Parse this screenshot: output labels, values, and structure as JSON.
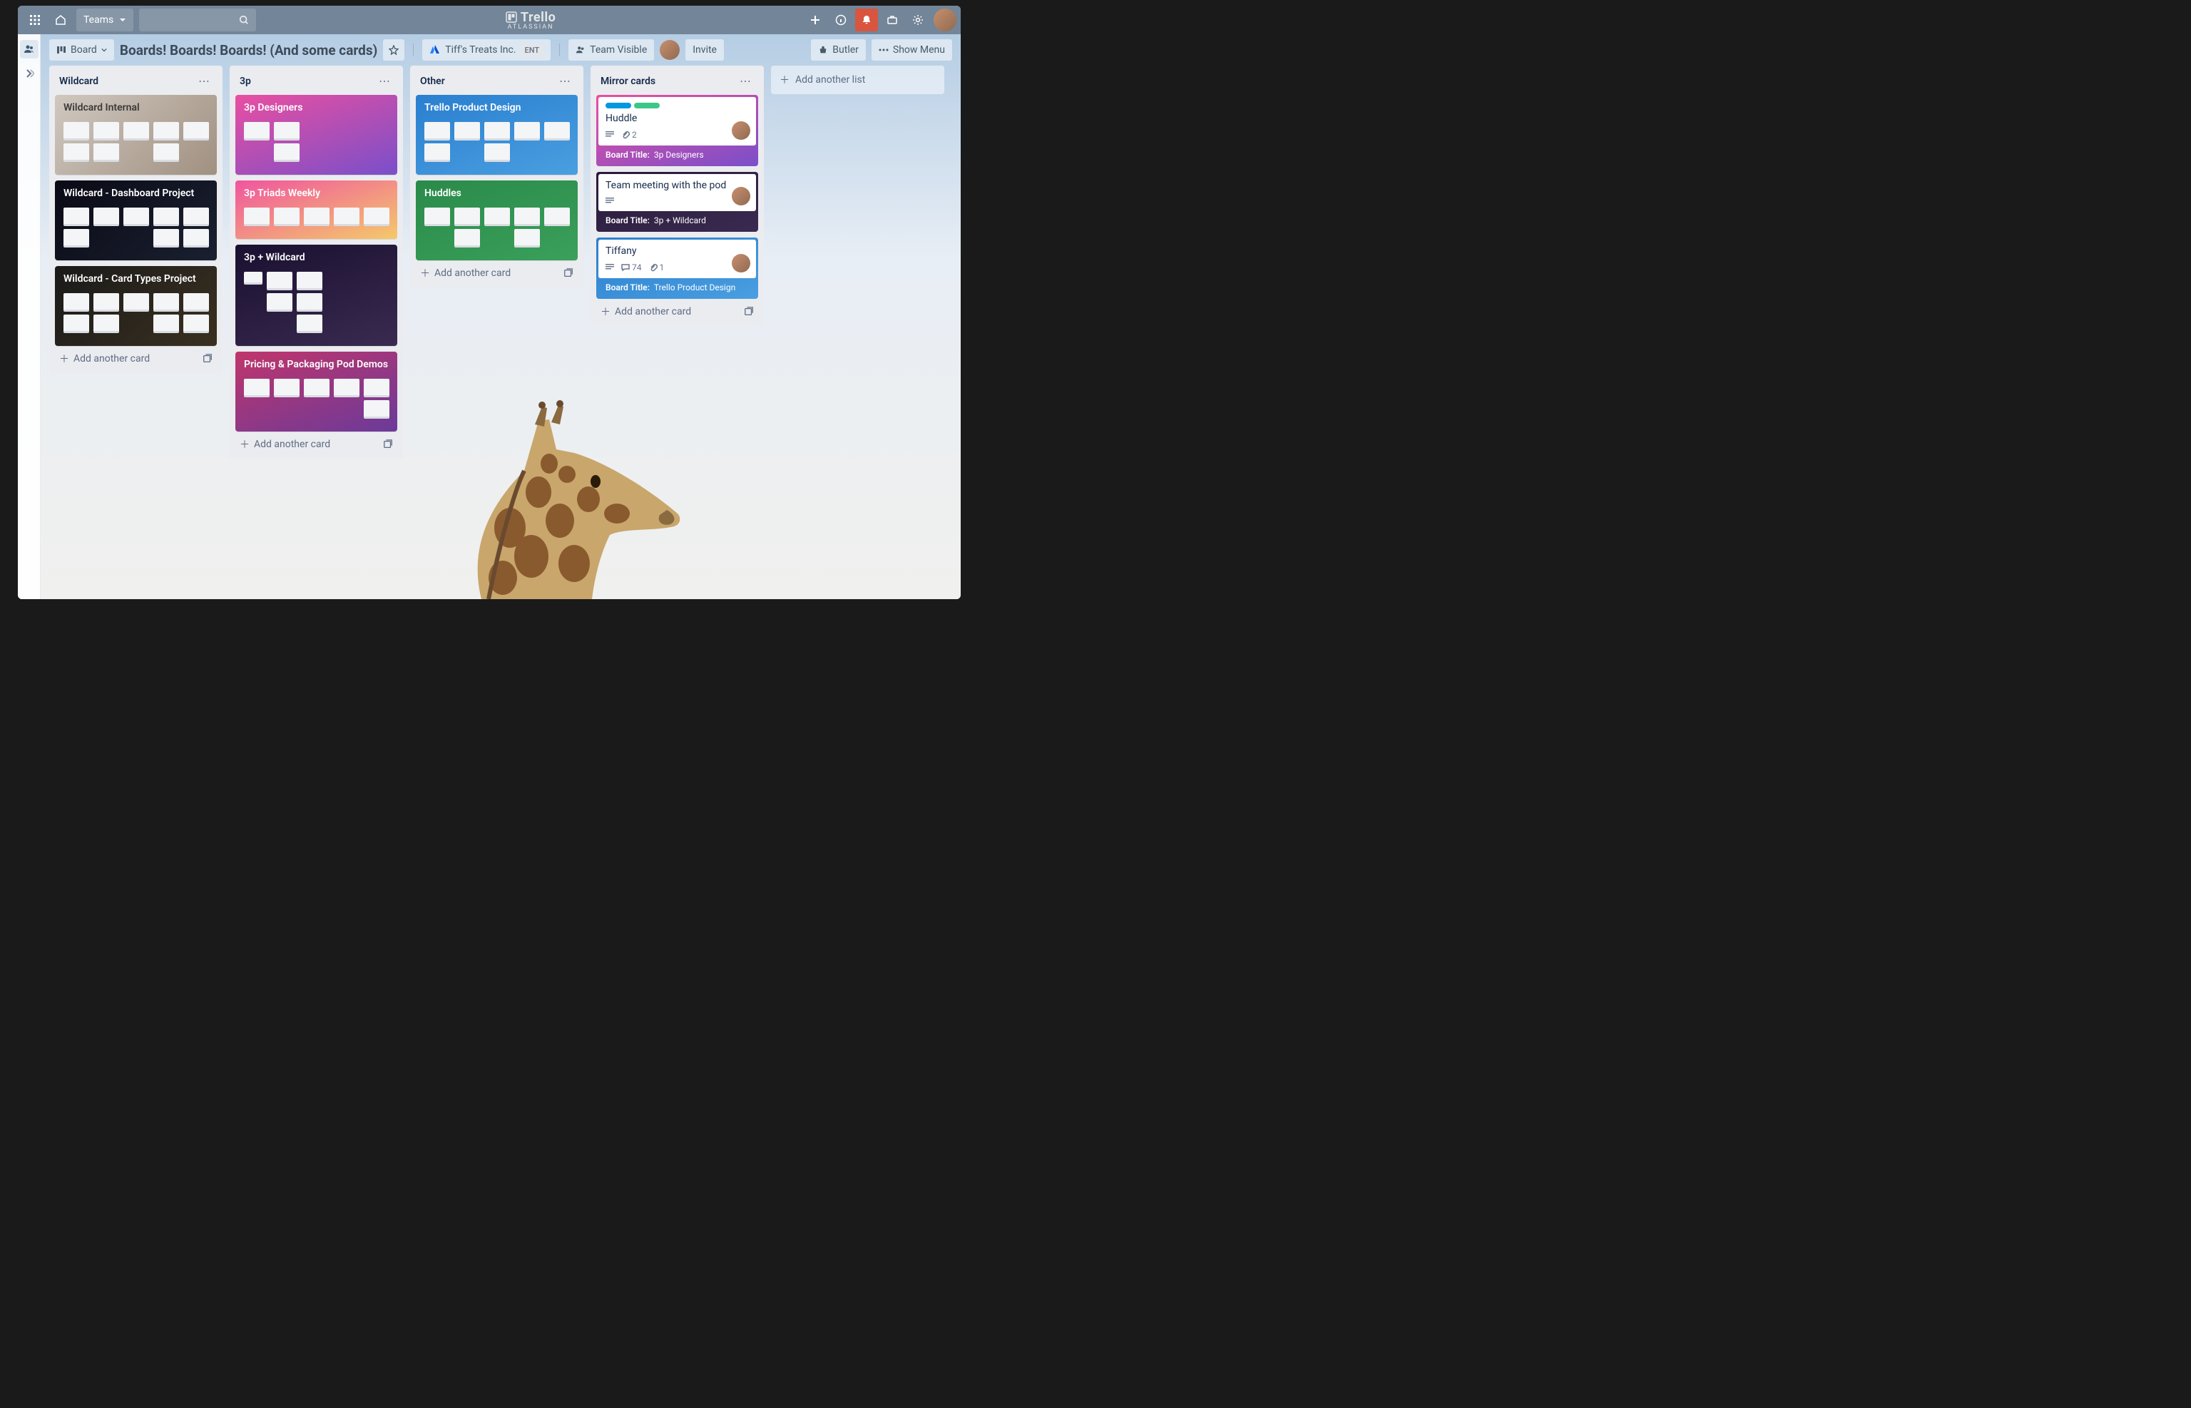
{
  "topbar": {
    "teams": "Teams",
    "brand": "Trello",
    "brand_sub": "ATLASSIAN"
  },
  "boardbar": {
    "view": "Board",
    "title": "Boards! Boards! Boards! (And some cards)",
    "workspace": "Tiff's Treats Inc.",
    "ent": "ENT",
    "visibility": "Team Visible",
    "invite": "Invite",
    "butler": "Butler",
    "menu": "Show Menu"
  },
  "lists": {
    "wildcard": {
      "title": "Wildcard"
    },
    "threep": {
      "title": "3p"
    },
    "other": {
      "title": "Other"
    },
    "mirror": {
      "title": "Mirror cards"
    }
  },
  "cards": {
    "wildcard_internal": "Wildcard Internal",
    "wildcard_dashboard": "Wildcard - Dashboard Project",
    "wildcard_cardtypes": "Wildcard - Card Types Project",
    "designers": "3p Designers",
    "triads": "3p Triads Weekly",
    "pluswild": "3p + Wildcard",
    "pricing": "Pricing & Packaging Pod Demos",
    "tpd": "Trello Product Design",
    "huddles": "Huddles"
  },
  "mirror_cards": {
    "huddle": {
      "title": "Huddle",
      "attach": "2",
      "board_label": "Board Title:",
      "board": "3p Designers"
    },
    "team": {
      "title": "Team meeting with the pod",
      "board_label": "Board Title:",
      "board": "3p + Wildcard"
    },
    "tiffany": {
      "title": "Tiffany",
      "comments": "74",
      "attach": "1",
      "board_label": "Board Title:",
      "board": "Trello Product Design"
    }
  },
  "actions": {
    "add_card": "Add another card",
    "add_list": "Add another list"
  }
}
